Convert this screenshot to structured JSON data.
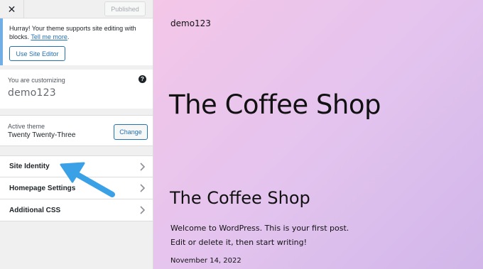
{
  "topbar": {
    "close_glyph": "✕",
    "published_label": "Published"
  },
  "notice": {
    "text": "Hurray! Your theme supports site editing with blocks.",
    "link": "Tell me more",
    "link_suffix": ".",
    "button_label": "Use Site Editor"
  },
  "customizing": {
    "label": "You are customizing",
    "site_name": "demo123",
    "help_glyph": "?"
  },
  "theme": {
    "label": "Active theme",
    "name": "Twenty Twenty-Three",
    "change_label": "Change"
  },
  "menu": {
    "items": [
      {
        "label": "Site Identity"
      },
      {
        "label": "Homepage Settings"
      },
      {
        "label": "Additional CSS"
      }
    ]
  },
  "preview": {
    "site_name": "demo123",
    "hero_title": "The Coffee Shop",
    "post_title": "The Coffee Shop",
    "excerpt_line1": "Welcome to WordPress. This is your first post.",
    "excerpt_line2": "Edit or delete it, then start writing!",
    "date": "November 14, 2022"
  },
  "colors": {
    "accent": "#2271b1",
    "notice_border": "#72aee6",
    "arrow": "#3ba1e6",
    "preview_gradient_start": "#f4c6e8",
    "preview_gradient_end": "#d1b6ea"
  },
  "icons": {
    "close": "close-icon",
    "help": "help-icon",
    "chevron": "chevron-right-icon",
    "annotation": "pointer-arrow"
  }
}
